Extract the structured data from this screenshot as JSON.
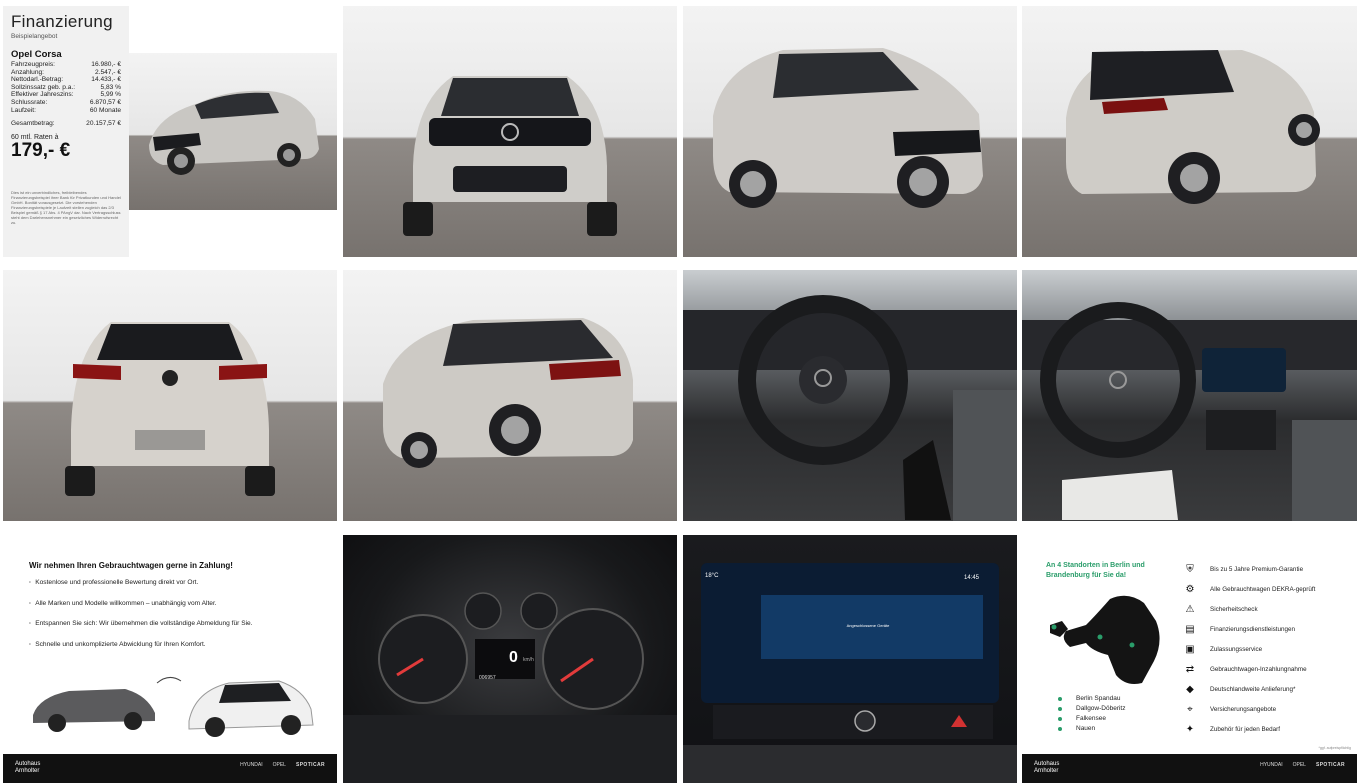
{
  "finance": {
    "title": "Finanzierung",
    "subtitle": "Beispielangebot",
    "model": "Opel Corsa",
    "rows": [
      {
        "label": "Fahrzeugpreis:",
        "value": "16.980,- €"
      },
      {
        "label": "Anzahlung:",
        "value": "2.547,- €"
      },
      {
        "label": "Nettodarl.-Betrag:",
        "value": "14.433,- €"
      },
      {
        "label": "Sollzinssatz geb. p.a.:",
        "value": "5,83 %"
      },
      {
        "label": "Effektiver Jahreszins:",
        "value": "5,99 %"
      },
      {
        "label": "Schlussrate:",
        "value": "6.870,57 €"
      },
      {
        "label": "Laufzeit:",
        "value": "60 Monate"
      }
    ],
    "total_label": "Gesamtbetrag:",
    "total_value": "20.157,57 €",
    "rate_label": "60 mtl. Raten à",
    "rate_value": "179,- €",
    "disclaimer": "Dies ist ein unverbindliches, freibleibendes Finanzierungsbeispiel ihrer Bank für Privatkunden und Handel GmbH. Bonität vorausgesetzt. Die vorstehenden Finanzierungsbeispiele je Laufzeit stellen zugleich das 2/3 Beispiel gemäß § 17 Abs. 4 PAngV dar. Nach Vertragsschluss steht dem Darlehensnehmer ein gesetzliches Widerrufsrecht zu."
  },
  "trade_in": {
    "title": "Wir nehmen Ihren Gebrauchtwagen gerne in Zahlung!",
    "bullets": [
      "Kostenlose und professionelle Bewertung direkt vor Ort.",
      "Alle Marken und Modelle willkommen – unabhängig vom Alter.",
      "Entspannen Sie sich: Wir übernehmen die vollständige Abmeldung für Sie.",
      "Schnelle und unkomplizierte Abwicklung für Ihren Komfort."
    ]
  },
  "footer": {
    "brand_line1": "Autohaus",
    "brand_line2": "Arnholter",
    "logos": [
      "HYUNDAI",
      "OPEL",
      "SPOTICAR"
    ]
  },
  "locations": {
    "title": "An 4 Standorten in Berlin und Brandenburg für Sie da!",
    "cities": [
      "Berlin Spandau",
      "Dallgow-Döberitz",
      "Falkensee",
      "Nauen"
    ],
    "services": [
      {
        "icon": "shield-check-icon",
        "glyph": "⛨",
        "label": "Bis zu 5 Jahre Premium-Garantie"
      },
      {
        "icon": "inspection-icon",
        "glyph": "⚙",
        "label": "Alle Gebrauchtwagen DEKRA-geprüft"
      },
      {
        "icon": "warning-triangle-icon",
        "glyph": "⚠",
        "label": "Sicherheitscheck"
      },
      {
        "icon": "finance-icon",
        "glyph": "▤",
        "label": "Finanzierungsdienstleistungen"
      },
      {
        "icon": "registration-icon",
        "glyph": "▣",
        "label": "Zulassungsservice"
      },
      {
        "icon": "trade-in-icon",
        "glyph": "⇄",
        "label": "Gebrauchtwagen-Inzahlungnahme"
      },
      {
        "icon": "germany-icon",
        "glyph": "◆",
        "label": "Deutschlandweite Anlieferung*"
      },
      {
        "icon": "location-pin-icon",
        "glyph": "⌖",
        "label": "Versicherungsangebote"
      },
      {
        "icon": "accessory-icon",
        "glyph": "✦",
        "label": "Zubehör für jeden Bedarf"
      }
    ],
    "note": "*ggf. aufpreispflichtig"
  },
  "dashboard": {
    "speed": "0",
    "speed_unit": "km/h",
    "odometer": "006957"
  },
  "infotainment": {
    "temperature": "18°C",
    "time": "14:45",
    "title": "Angeschlossene Geräte"
  },
  "colors": {
    "accent_green": "#2a9d6a",
    "footer_bg": "#111111",
    "car_silver": "#c8c6c2"
  }
}
